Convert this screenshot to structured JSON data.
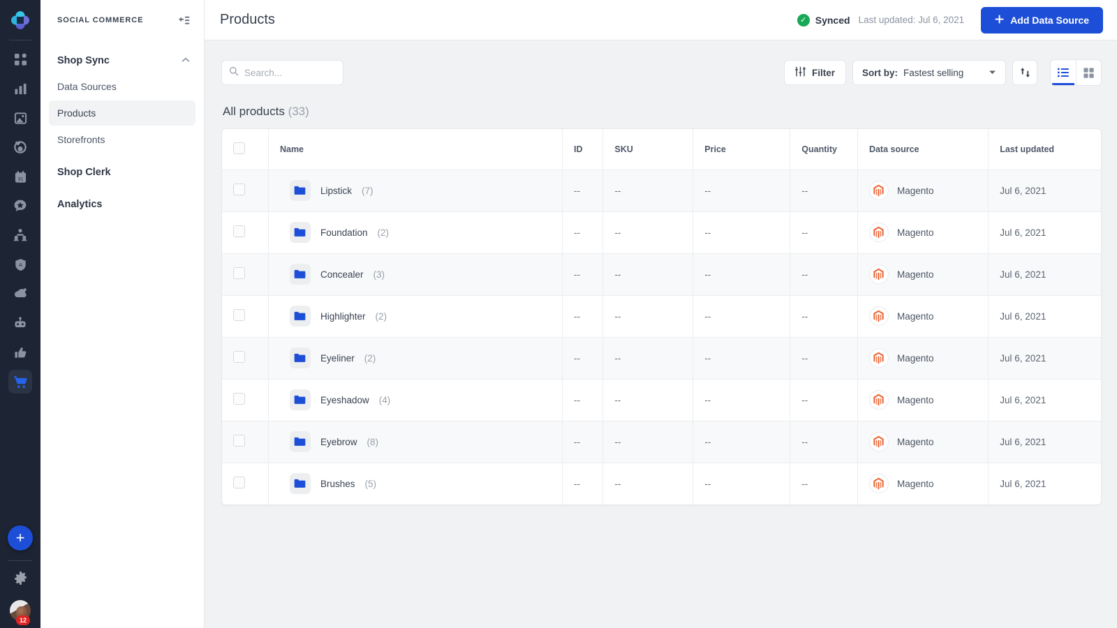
{
  "rail": {
    "logo_name": "app-logo",
    "items": [
      {
        "name": "dashboard-icon",
        "label": "Dashboard",
        "active": false
      },
      {
        "name": "analytics-bar-chart-icon",
        "label": "Reports",
        "active": false
      },
      {
        "name": "image-icon",
        "label": "Media",
        "active": false
      },
      {
        "name": "engagement-icon",
        "label": "Engagement",
        "active": false
      },
      {
        "name": "calendar-icon",
        "label": "Calendar",
        "active": false
      },
      {
        "name": "star-message-icon",
        "label": "Reviews",
        "active": false
      },
      {
        "name": "audience-icon",
        "label": "Audience",
        "active": false
      },
      {
        "name": "shield-icon",
        "label": "Moderation",
        "active": false
      },
      {
        "name": "megaphone-icon",
        "label": "Campaigns",
        "active": false
      },
      {
        "name": "bot-icon",
        "label": "Automation",
        "active": false
      },
      {
        "name": "thumbs-up-icon",
        "label": "Advocacy",
        "active": false
      },
      {
        "name": "shopping-cart-icon",
        "label": "Social Commerce",
        "active": true
      }
    ],
    "add_label": "+",
    "settings_name": "gear-icon",
    "avatar_badge": "12"
  },
  "sidebar": {
    "title": "SOCIAL COMMERCE",
    "collapse_name": "collapse-sidebar-icon",
    "groups": [
      {
        "label": "Shop Sync",
        "expanded": true,
        "items": [
          {
            "label": "Data Sources",
            "active": false
          },
          {
            "label": "Products",
            "active": true
          },
          {
            "label": "Storefronts",
            "active": false
          }
        ]
      },
      {
        "label": "Shop Clerk",
        "expanded": false,
        "items": []
      },
      {
        "label": "Analytics",
        "expanded": false,
        "items": []
      }
    ]
  },
  "header": {
    "title": "Products",
    "sync_status": "Synced",
    "last_updated": "Last updated: Jul 6, 2021",
    "add_button": "Add Data Source",
    "status_color": "#18a957",
    "accent_color": "#1d4ed8"
  },
  "toolbar": {
    "search_placeholder": "Search...",
    "search_value": "",
    "filter_label": "Filter",
    "sort_label": "Sort by:",
    "sort_value": "Fastest selling",
    "sort_direction_name": "sort-direction-toggle",
    "view_list_name": "list-view-button",
    "view_grid_name": "grid-view-button",
    "active_view": "list"
  },
  "list": {
    "title": "All products",
    "count": "(33)",
    "columns": [
      "Name",
      "ID",
      "SKU",
      "Price",
      "Quantity",
      "Data source",
      "Last updated"
    ],
    "rows": [
      {
        "name": "Lipstick",
        "count": "(7)",
        "id": "--",
        "sku": "--",
        "price": "--",
        "quantity": "--",
        "source": "Magento",
        "updated": "Jul 6, 2021"
      },
      {
        "name": "Foundation",
        "count": "(2)",
        "id": "--",
        "sku": "--",
        "price": "--",
        "quantity": "--",
        "source": "Magento",
        "updated": "Jul 6, 2021"
      },
      {
        "name": "Concealer",
        "count": "(3)",
        "id": "--",
        "sku": "--",
        "price": "--",
        "quantity": "--",
        "source": "Magento",
        "updated": "Jul 6, 2021"
      },
      {
        "name": "Highlighter",
        "count": "(2)",
        "id": "--",
        "sku": "--",
        "price": "--",
        "quantity": "--",
        "source": "Magento",
        "updated": "Jul 6, 2021"
      },
      {
        "name": "Eyeliner",
        "count": "(2)",
        "id": "--",
        "sku": "--",
        "price": "--",
        "quantity": "--",
        "source": "Magento",
        "updated": "Jul 6, 2021"
      },
      {
        "name": "Eyeshadow",
        "count": "(4)",
        "id": "--",
        "sku": "--",
        "price": "--",
        "quantity": "--",
        "source": "Magento",
        "updated": "Jul 6, 2021"
      },
      {
        "name": "Eyebrow",
        "count": "(8)",
        "id": "--",
        "sku": "--",
        "price": "--",
        "quantity": "--",
        "source": "Magento",
        "updated": "Jul 6, 2021"
      },
      {
        "name": "Brushes",
        "count": "(5)",
        "id": "--",
        "sku": "--",
        "price": "--",
        "quantity": "--",
        "source": "Magento",
        "updated": "Jul 6, 2021"
      }
    ]
  }
}
